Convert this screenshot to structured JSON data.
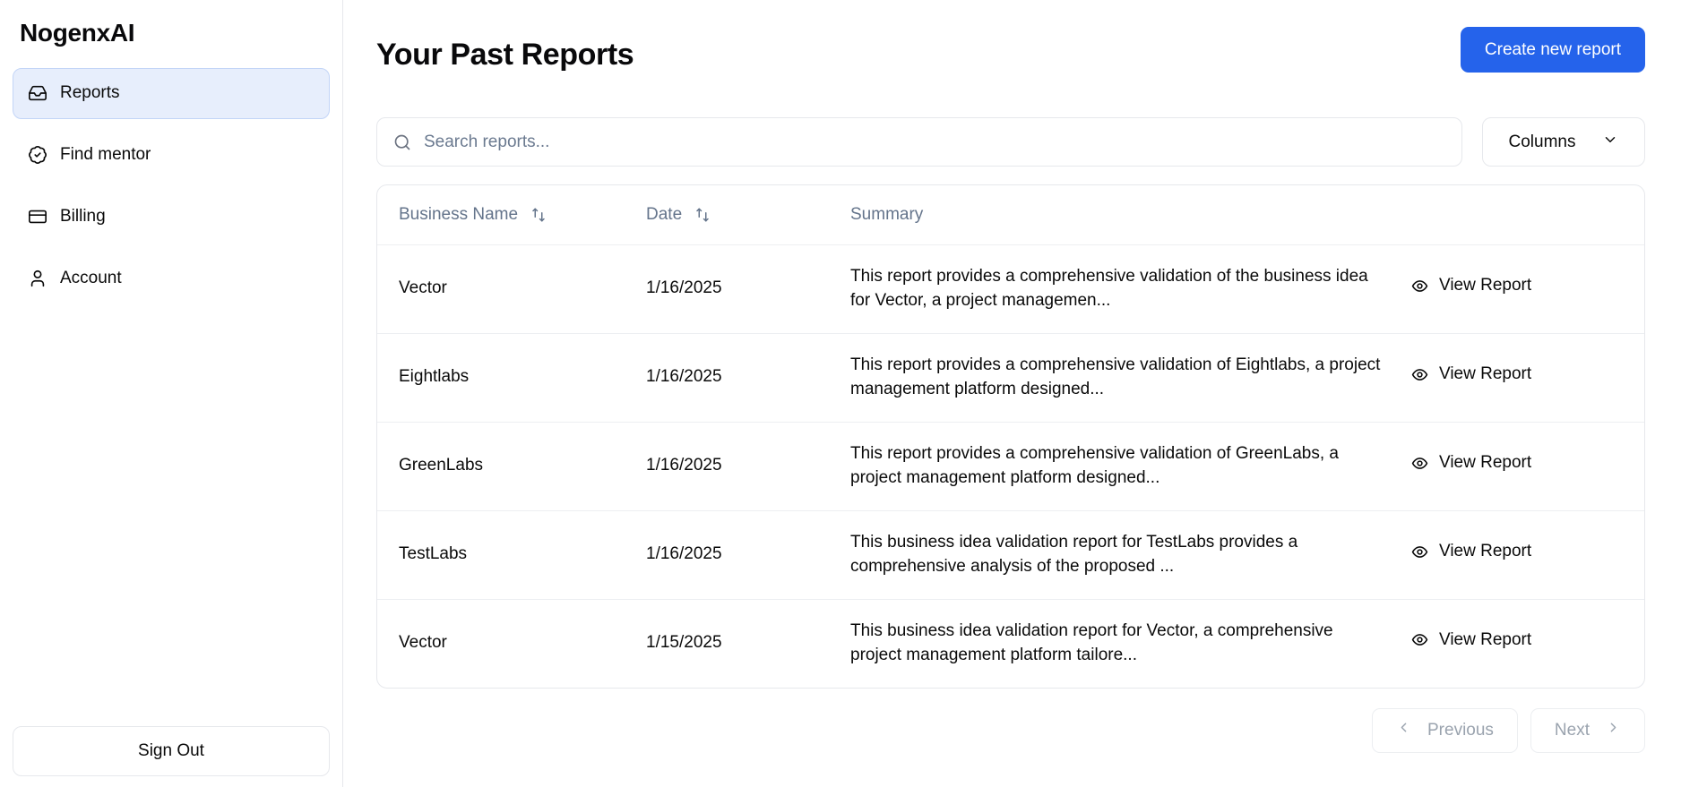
{
  "sidebar": {
    "brand": "NogenxAI",
    "items": [
      {
        "label": "Reports",
        "icon": "inbox-icon",
        "active": true
      },
      {
        "label": "Find mentor",
        "icon": "badge-check-icon",
        "active": false
      },
      {
        "label": "Billing",
        "icon": "credit-card-icon",
        "active": false
      },
      {
        "label": "Account",
        "icon": "user-icon",
        "active": false
      }
    ],
    "sign_out_label": "Sign Out"
  },
  "header": {
    "title": "Your Past Reports",
    "create_button_label": "Create new report"
  },
  "toolbar": {
    "search_placeholder": "Search reports...",
    "search_value": "",
    "search_icon": "search-icon",
    "columns_label": "Columns",
    "columns_chevron": "chevron-down-icon"
  },
  "table": {
    "columns": [
      {
        "label": "Business Name",
        "sortable": true
      },
      {
        "label": "Date",
        "sortable": true
      },
      {
        "label": "Summary",
        "sortable": false
      },
      {
        "label": "",
        "sortable": false
      }
    ],
    "action_label": "View Report",
    "action_icon": "eye-icon",
    "rows": [
      {
        "business_name": "Vector",
        "date": "1/16/2025",
        "summary": "This report provides a comprehensive validation of the business idea for Vector, a project managemen...",
        "action": "View Report"
      },
      {
        "business_name": "Eightlabs",
        "date": "1/16/2025",
        "summary": "This report provides a comprehensive validation of Eightlabs, a project management platform designed...",
        "action": "View Report"
      },
      {
        "business_name": "GreenLabs",
        "date": "1/16/2025",
        "summary": "This report provides a comprehensive validation of GreenLabs, a project management platform designed...",
        "action": "View Report"
      },
      {
        "business_name": "TestLabs",
        "date": "1/16/2025",
        "summary": "This business idea validation report for TestLabs provides a comprehensive analysis of the proposed ...",
        "action": "View Report"
      },
      {
        "business_name": "Vector",
        "date": "1/15/2025",
        "summary": "This business idea validation report for Vector, a comprehensive project management platform tailore...",
        "action": "View Report"
      }
    ]
  },
  "pagination": {
    "previous_label": "Previous",
    "next_label": "Next",
    "prev_icon": "chevron-left-icon",
    "next_icon": "chevron-right-icon"
  },
  "colors": {
    "accent": "#2563eb",
    "active_nav_bg": "#e7eefc",
    "active_nav_border": "#c3d5f7",
    "border": "#e6e8ec",
    "muted_text": "#64748b",
    "disabled_text": "#9aa3ae"
  }
}
